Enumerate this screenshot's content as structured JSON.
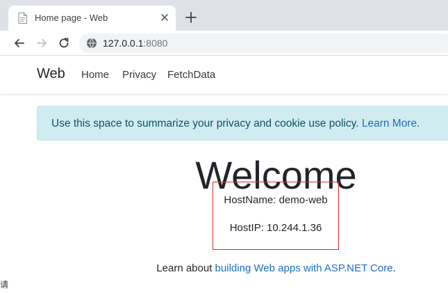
{
  "browser": {
    "tab": {
      "title": "Home page - Web"
    },
    "address": {
      "host": "127.0.0.1",
      "port": ":8080"
    }
  },
  "site": {
    "brand": "Web",
    "nav": [
      "Home",
      "Privacy",
      "FetchData"
    ]
  },
  "cookie": {
    "text": "Use this space to summarize your privacy and cookie use policy. ",
    "link": "Learn More",
    "suffix": "."
  },
  "main": {
    "heading": "Welcome",
    "hostname": "HostName: demo-web",
    "hostip": "HostIP: 10.244.1.36",
    "learn_prefix": "Learn about ",
    "learn_link": "building Web apps with ASP.NET Core",
    "learn_suffix": "."
  },
  "colors": {
    "link": "#1b6ec2",
    "alert_bg": "#d1ecf1",
    "alert_text": "#0c5460",
    "highlight_border": "#d32f2f",
    "chrome_bg": "#dee1e6"
  },
  "icons": [
    "document-favicon-icon",
    "close-icon",
    "plus-icon",
    "back-arrow-icon",
    "forward-arrow-icon",
    "reload-icon",
    "globe-icon"
  ],
  "edge_glyph": "请"
}
